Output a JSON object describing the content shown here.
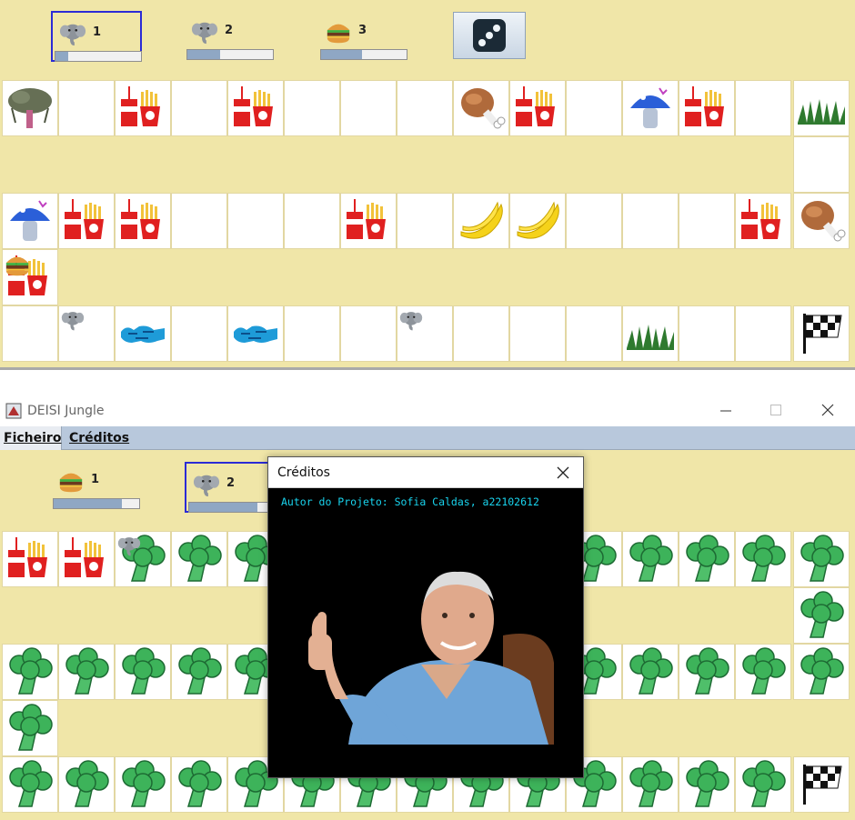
{
  "colors": {
    "board_bg": "#f0e6a8",
    "cell_bg": "#ffffff",
    "selection_border": "#2b2bd6",
    "progress_fill": "#8fa7c4",
    "credit_text": "#19d4ee"
  },
  "top_game": {
    "players": [
      {
        "number": "1",
        "icon": "elephant-icon",
        "progress": 0.15,
        "selected": true
      },
      {
        "number": "2",
        "icon": "elephant-icon",
        "progress": 0.38,
        "selected": false
      },
      {
        "number": "3",
        "icon": "hamburger-icon",
        "progress": 0.48,
        "selected": false
      }
    ],
    "dice_icon": "dice-icon"
  },
  "bottom_window": {
    "title": "DEISI Jungle",
    "window_controls": [
      "minimize-icon",
      "maximize-icon",
      "close-icon"
    ],
    "menu": [
      "Ficheiro",
      "Créditos"
    ],
    "players": [
      {
        "number": "1",
        "icon": "hamburger-icon",
        "progress": 0.8,
        "selected": false
      },
      {
        "number": "2",
        "icon": "elephant-icon",
        "progress": 0.8,
        "selected": true
      }
    ]
  },
  "credits_dialog": {
    "title": "Créditos",
    "text": "Autor do Projeto: Sofia Caldas, a22102612",
    "image": "author-photo"
  }
}
